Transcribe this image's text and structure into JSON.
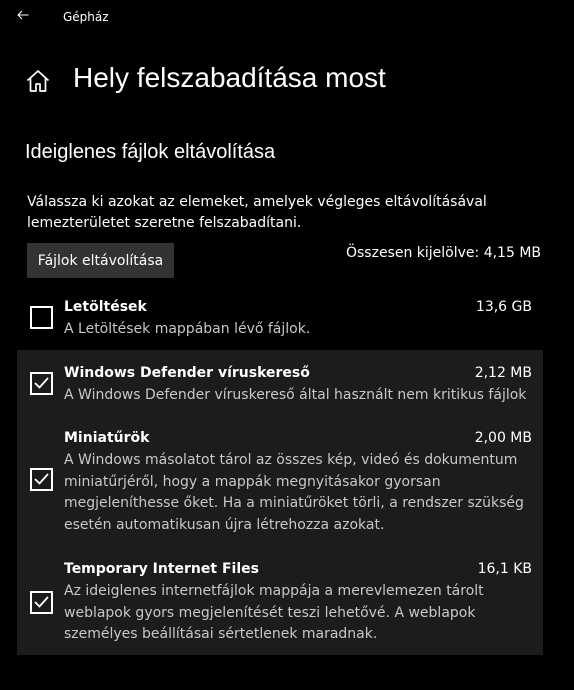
{
  "window": {
    "title": "Gépház"
  },
  "header": {
    "title": "Hely felszabadítása most"
  },
  "section": {
    "title": "Ideiglenes fájlok eltávolítása",
    "description": "Válassza ki azokat az elemeket, amelyek végleges eltávolításával lemezterületet szeretne felszabadítani.",
    "remove_button": "Fájlok eltávolítása",
    "total_selected": "Összesen kijelölve: 4,15 MB"
  },
  "items": [
    {
      "name": "Letöltések",
      "size": "13,6 GB",
      "description": "A Letöltések mappában lévő fájlok.",
      "checked": false
    },
    {
      "name": "Windows Defender víruskereső",
      "size": "2,12 MB",
      "description": "A Windows Defender víruskereső által használt nem kritikus fájlok",
      "checked": true
    },
    {
      "name": "Miniatűrök",
      "size": "2,00 MB",
      "description": "A Windows másolatot tárol az összes kép, videó és dokumentum miniatűrjéről, hogy a mappák megnyitásakor gyorsan megjeleníthesse őket. Ha a miniatűröket törli, a rendszer szükség esetén automatikusan újra létrehozza azokat.",
      "checked": true
    },
    {
      "name": "Temporary Internet Files",
      "size": "16,1 KB",
      "description": "Az ideiglenes internetfájlok mappája a merevlemezen tárolt weblapok gyors megjelenítését teszi lehetővé. A weblapok személyes beállításai sértetlenek maradnak.",
      "checked": true
    }
  ],
  "icons": {
    "back": "back-arrow-icon",
    "home": "home-icon",
    "check": "checkmark-icon"
  }
}
